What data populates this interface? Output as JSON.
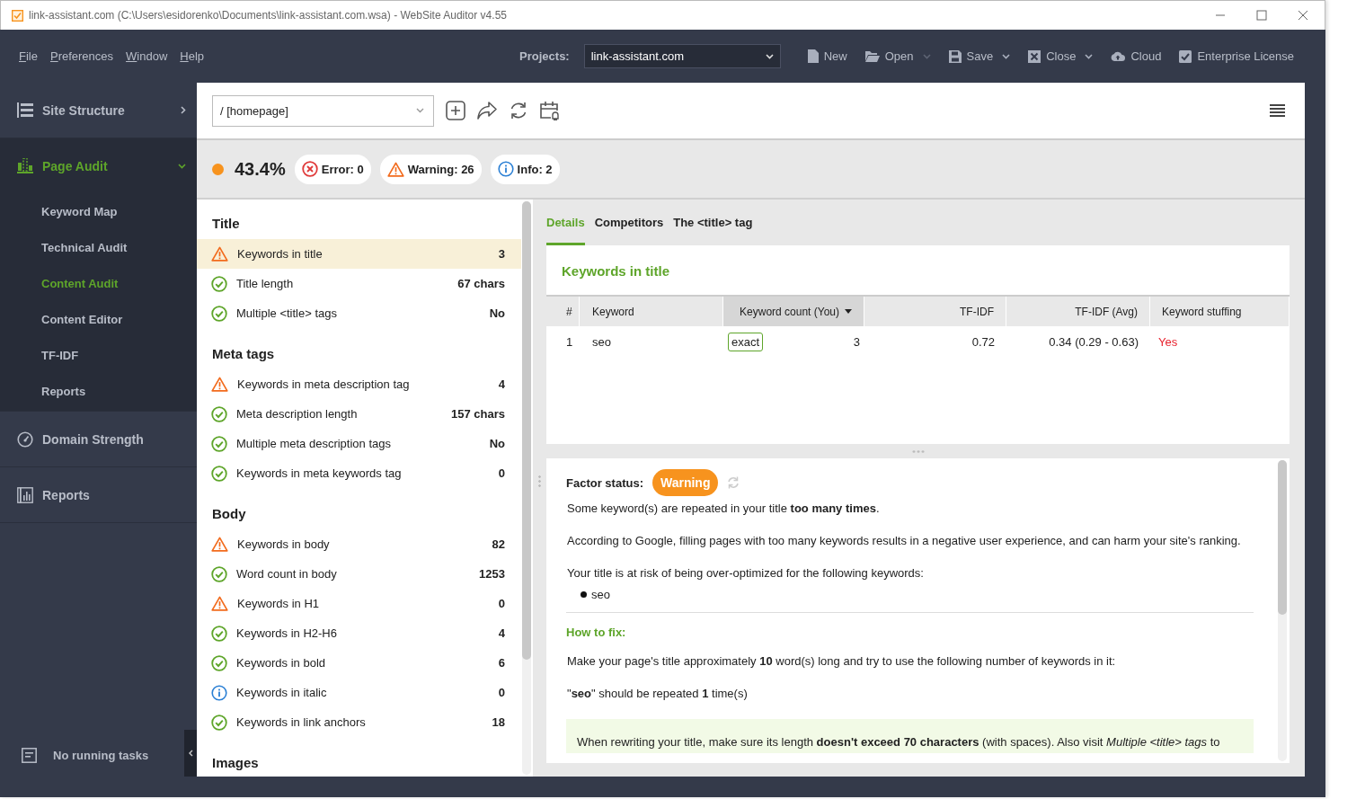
{
  "window": {
    "title": "link-assistant.com (C:\\Users\\esidorenko\\Documents\\link-assistant.com.wsa) - WebSite Auditor v4.55"
  },
  "menu": [
    "File",
    "Preferences",
    "Window",
    "Help"
  ],
  "projects": {
    "label": "Projects:",
    "value": "link-assistant.com"
  },
  "toolbar": [
    {
      "kind": "new",
      "label": "New",
      "dropdown": false,
      "disabled": false
    },
    {
      "kind": "open",
      "label": "Open",
      "dropdown": true,
      "disabled": true
    },
    {
      "kind": "save",
      "label": "Save",
      "dropdown": true,
      "disabled": false
    },
    {
      "kind": "close",
      "label": "Close",
      "dropdown": true,
      "disabled": false
    },
    {
      "kind": "cloud",
      "label": "Cloud",
      "dropdown": false,
      "disabled": false
    },
    {
      "kind": "license",
      "label": "Enterprise License",
      "dropdown": false,
      "disabled": false
    }
  ],
  "sidebar": {
    "sections": [
      {
        "kind": "structure",
        "label": "Site Structure",
        "expanded": false,
        "selected": false
      },
      {
        "kind": "audit",
        "label": "Page Audit",
        "expanded": true,
        "selected": true,
        "children": [
          {
            "label": "Keyword Map",
            "selected": false
          },
          {
            "label": "Technical Audit",
            "selected": false
          },
          {
            "label": "Content Audit",
            "selected": true
          },
          {
            "label": "Content Editor",
            "selected": false
          },
          {
            "label": "TF-IDF",
            "selected": false
          },
          {
            "label": "Reports",
            "selected": false
          }
        ]
      },
      {
        "kind": "domain",
        "label": "Domain Strength",
        "selected": false
      },
      {
        "kind": "reports",
        "label": "Reports",
        "selected": false
      }
    ],
    "status": "No running tasks"
  },
  "page_select": {
    "value": "/ [homepage]"
  },
  "score": {
    "value": "43.4%",
    "color": "#f7931e"
  },
  "badges": [
    {
      "kind": "error",
      "label": "Error: 0"
    },
    {
      "kind": "warning",
      "label": "Warning: 26"
    },
    {
      "kind": "info",
      "label": "Info: 2"
    }
  ],
  "factor_groups": [
    {
      "title": "Title",
      "items": [
        {
          "kind": "warning",
          "label": "Keywords in title",
          "value": "3",
          "selected": true
        },
        {
          "kind": "ok",
          "label": "Title length",
          "value": "67 chars",
          "selected": false
        },
        {
          "kind": "ok",
          "label": "Multiple <title> tags",
          "value": "No",
          "selected": false
        }
      ]
    },
    {
      "title": "Meta tags",
      "items": [
        {
          "kind": "warning",
          "label": "Keywords in meta description tag",
          "value": "4",
          "selected": false
        },
        {
          "kind": "ok",
          "label": "Meta description length",
          "value": "157 chars",
          "selected": false
        },
        {
          "kind": "ok",
          "label": "Multiple meta description tags",
          "value": "No",
          "selected": false
        },
        {
          "kind": "ok",
          "label": "Keywords in meta keywords tag",
          "value": "0",
          "selected": false
        }
      ]
    },
    {
      "title": "Body",
      "items": [
        {
          "kind": "warning",
          "label": "Keywords in body",
          "value": "82",
          "selected": false
        },
        {
          "kind": "ok",
          "label": "Word count in body",
          "value": "1253",
          "selected": false
        },
        {
          "kind": "warning",
          "label": "Keywords in H1",
          "value": "0",
          "selected": false
        },
        {
          "kind": "ok",
          "label": "Keywords in H2-H6",
          "value": "4",
          "selected": false
        },
        {
          "kind": "ok",
          "label": "Keywords in bold",
          "value": "6",
          "selected": false
        },
        {
          "kind": "info",
          "label": "Keywords in italic",
          "value": "0",
          "selected": false
        },
        {
          "kind": "ok",
          "label": "Keywords in link anchors",
          "value": "18",
          "selected": false
        }
      ]
    },
    {
      "title": "Images"
    }
  ],
  "detail_tabs": [
    {
      "label": "Details",
      "selected": true
    },
    {
      "label": "Competitors",
      "selected": false
    },
    {
      "label": "The <title> tag",
      "selected": false
    }
  ],
  "keyword_table": {
    "title": "Keywords in title",
    "columns": [
      {
        "label": "#",
        "sorted": false
      },
      {
        "label": "Keyword",
        "sorted": false
      },
      {
        "label": "Keyword count (You)",
        "sorted": true
      },
      {
        "label": "TF-IDF",
        "sorted": false
      },
      {
        "label": "TF-IDF (Avg)",
        "sorted": false
      },
      {
        "label": "Keyword stuffing",
        "sorted": false
      }
    ],
    "rows": [
      {
        "cells": [
          "1",
          "seo",
          "3",
          "0.72",
          "0.34 (0.29 - 0.63)",
          "Yes"
        ],
        "match": "exact",
        "stuffing": true
      }
    ]
  },
  "factor_status": {
    "label": "Factor status:",
    "badge": {
      "kind": "warning",
      "label": "Warning"
    },
    "paragraphs": [
      "Some keyword(s) are repeated in your title **too many times**.",
      "According to Google, filling pages with too many keywords results in a negative user experience, and can harm your site's ranking.",
      "Your title is at risk of being over-optimized for the following keywords:"
    ],
    "keywords": [
      "seo"
    ],
    "fix_title": "How to fix:",
    "fix_paragraphs": [
      "Make your page's title approximately **10** word(s) long and try to use the following number of keywords in it:",
      "\"**seo**\" should be repeated **1** time(s)"
    ],
    "note": "When rewriting your title, make sure its length **doesn't exceed 70 characters** (with spaces). Also visit *Multiple <title> tags* to"
  }
}
